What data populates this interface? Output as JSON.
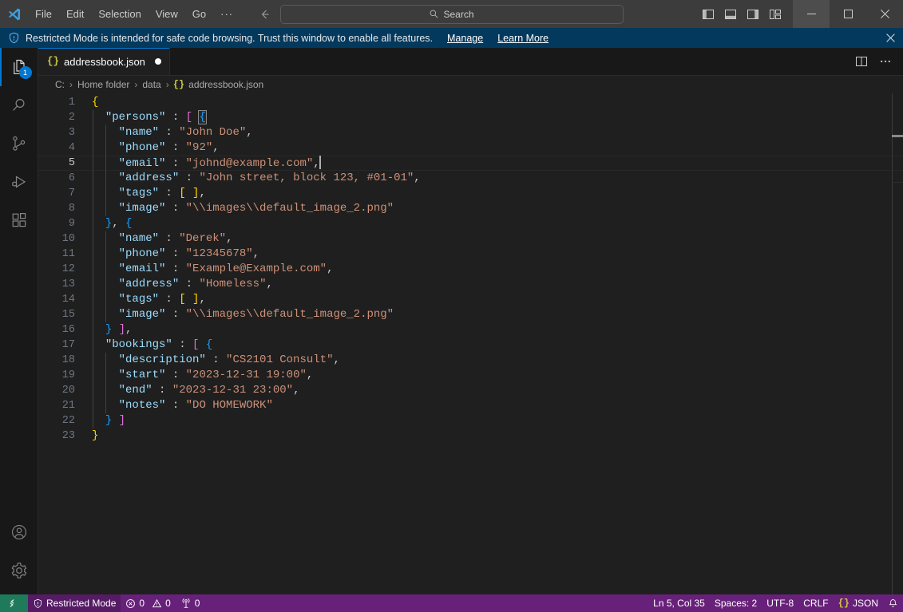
{
  "titlebar": {
    "logo_icon": "vscode-logo-icon",
    "menus": [
      {
        "label": "File",
        "name": "menu-file"
      },
      {
        "label": "Edit",
        "name": "menu-edit"
      },
      {
        "label": "Selection",
        "name": "menu-selection"
      },
      {
        "label": "View",
        "name": "menu-view"
      },
      {
        "label": "Go",
        "name": "menu-go"
      },
      {
        "label": "···",
        "name": "menu-more"
      }
    ],
    "nav": {
      "back_icon": "arrow-left-icon",
      "forward_icon": "arrow-right-icon"
    },
    "search": {
      "placeholder": "Search",
      "icon": "search-icon",
      "value": ""
    },
    "layout_buttons": [
      {
        "name": "toggle-primary-sidebar-button",
        "icon": "panel-left-icon"
      },
      {
        "name": "toggle-panel-button",
        "icon": "panel-bottom-icon"
      },
      {
        "name": "toggle-secondary-sidebar-button",
        "icon": "panel-right-icon"
      },
      {
        "name": "customize-layout-button",
        "icon": "layout-customize-icon"
      }
    ],
    "window_controls": [
      {
        "name": "minimize-button",
        "icon": "minimize-icon",
        "hovered": true
      },
      {
        "name": "maximize-button",
        "icon": "maximize-icon",
        "hovered": false
      },
      {
        "name": "close-button",
        "icon": "close-icon",
        "hovered": false
      }
    ]
  },
  "banner": {
    "icon": "shield-icon",
    "message": "Restricted Mode is intended for safe code browsing. Trust this window to enable all features.",
    "manage_label": "Manage",
    "learn_more_label": "Learn More",
    "close_icon": "close-icon"
  },
  "activitybar": {
    "top": [
      {
        "name": "sidebar-item-explorer",
        "icon": "files-icon",
        "active": true,
        "badge": "1"
      },
      {
        "name": "sidebar-item-search",
        "icon": "search-icon",
        "active": false,
        "badge": ""
      },
      {
        "name": "sidebar-item-source-control",
        "icon": "source-control-icon",
        "active": false,
        "badge": ""
      },
      {
        "name": "sidebar-item-run-debug",
        "icon": "run-and-debug-icon",
        "active": false,
        "badge": ""
      },
      {
        "name": "sidebar-item-extensions",
        "icon": "extensions-icon",
        "active": false,
        "badge": ""
      }
    ],
    "bottom": [
      {
        "name": "accounts-button",
        "icon": "account-icon"
      },
      {
        "name": "manage-settings-button",
        "icon": "gear-icon"
      }
    ]
  },
  "editor": {
    "tab": {
      "icon": "json-file-icon",
      "icon_glyph": "{}",
      "label": "addressbook.json",
      "dirty": true
    },
    "tab_actions": [
      {
        "name": "split-editor-right-button",
        "icon": "split-editor-icon"
      },
      {
        "name": "more-editor-actions-button",
        "icon": "ellipsis-icon"
      }
    ],
    "breadcrumbs": [
      {
        "label": "C:",
        "name": "breadcrumb-drive"
      },
      {
        "label": "Home folder",
        "name": "breadcrumb-home-folder"
      },
      {
        "label": "data",
        "name": "breadcrumb-data"
      },
      {
        "label": "addressbook.json",
        "name": "breadcrumb-file",
        "icon_glyph": "{}"
      }
    ],
    "separator": "›",
    "cursor_line": 5,
    "lines": [
      {
        "n": "1",
        "indent": 0,
        "tokens": [
          {
            "t": "{",
            "c": "tok-b1"
          }
        ]
      },
      {
        "n": "2",
        "indent": 1,
        "tokens": [
          {
            "t": "  ",
            "c": "tok-punct"
          },
          {
            "t": "\"persons\"",
            "c": "tok-key"
          },
          {
            "t": " : ",
            "c": "tok-punct"
          },
          {
            "t": "[",
            "c": "tok-b2"
          },
          {
            "t": " ",
            "c": "tok-punct"
          },
          {
            "t": "{",
            "c": "tok-b3 bracket-match"
          }
        ]
      },
      {
        "n": "3",
        "indent": 2,
        "tokens": [
          {
            "t": "    ",
            "c": "tok-punct"
          },
          {
            "t": "\"name\"",
            "c": "tok-key"
          },
          {
            "t": " : ",
            "c": "tok-punct"
          },
          {
            "t": "\"John Doe\"",
            "c": "tok-str"
          },
          {
            "t": ",",
            "c": "tok-punct"
          }
        ]
      },
      {
        "n": "4",
        "indent": 2,
        "tokens": [
          {
            "t": "    ",
            "c": "tok-punct"
          },
          {
            "t": "\"phone\"",
            "c": "tok-key"
          },
          {
            "t": " : ",
            "c": "tok-punct"
          },
          {
            "t": "\"92\"",
            "c": "tok-str"
          },
          {
            "t": ",",
            "c": "tok-punct"
          }
        ]
      },
      {
        "n": "5",
        "indent": 2,
        "current": true,
        "caret": true,
        "tokens": [
          {
            "t": "    ",
            "c": "tok-punct"
          },
          {
            "t": "\"email\"",
            "c": "tok-key"
          },
          {
            "t": " : ",
            "c": "tok-punct"
          },
          {
            "t": "\"johnd@example.com\"",
            "c": "tok-str"
          },
          {
            "t": ",",
            "c": "tok-punct"
          }
        ]
      },
      {
        "n": "6",
        "indent": 2,
        "tokens": [
          {
            "t": "    ",
            "c": "tok-punct"
          },
          {
            "t": "\"address\"",
            "c": "tok-key"
          },
          {
            "t": " : ",
            "c": "tok-punct"
          },
          {
            "t": "\"John street, block 123, #01-01\"",
            "c": "tok-str"
          },
          {
            "t": ",",
            "c": "tok-punct"
          }
        ]
      },
      {
        "n": "7",
        "indent": 2,
        "tokens": [
          {
            "t": "    ",
            "c": "tok-punct"
          },
          {
            "t": "\"tags\"",
            "c": "tok-key"
          },
          {
            "t": " : ",
            "c": "tok-punct"
          },
          {
            "t": "[ ]",
            "c": "tok-b1"
          },
          {
            "t": ",",
            "c": "tok-punct"
          }
        ]
      },
      {
        "n": "8",
        "indent": 2,
        "tokens": [
          {
            "t": "    ",
            "c": "tok-punct"
          },
          {
            "t": "\"image\"",
            "c": "tok-key"
          },
          {
            "t": " : ",
            "c": "tok-punct"
          },
          {
            "t": "\"\\\\images\\\\default_image_2.png\"",
            "c": "tok-str"
          }
        ]
      },
      {
        "n": "9",
        "indent": 1,
        "tokens": [
          {
            "t": "  ",
            "c": "tok-punct"
          },
          {
            "t": "}",
            "c": "tok-b3"
          },
          {
            "t": ", ",
            "c": "tok-punct"
          },
          {
            "t": "{",
            "c": "tok-b3"
          }
        ]
      },
      {
        "n": "10",
        "indent": 2,
        "tokens": [
          {
            "t": "    ",
            "c": "tok-punct"
          },
          {
            "t": "\"name\"",
            "c": "tok-key"
          },
          {
            "t": " : ",
            "c": "tok-punct"
          },
          {
            "t": "\"Derek\"",
            "c": "tok-str"
          },
          {
            "t": ",",
            "c": "tok-punct"
          }
        ]
      },
      {
        "n": "11",
        "indent": 2,
        "tokens": [
          {
            "t": "    ",
            "c": "tok-punct"
          },
          {
            "t": "\"phone\"",
            "c": "tok-key"
          },
          {
            "t": " : ",
            "c": "tok-punct"
          },
          {
            "t": "\"12345678\"",
            "c": "tok-str"
          },
          {
            "t": ",",
            "c": "tok-punct"
          }
        ]
      },
      {
        "n": "12",
        "indent": 2,
        "tokens": [
          {
            "t": "    ",
            "c": "tok-punct"
          },
          {
            "t": "\"email\"",
            "c": "tok-key"
          },
          {
            "t": " : ",
            "c": "tok-punct"
          },
          {
            "t": "\"Example@Example.com\"",
            "c": "tok-str"
          },
          {
            "t": ",",
            "c": "tok-punct"
          }
        ]
      },
      {
        "n": "13",
        "indent": 2,
        "tokens": [
          {
            "t": "    ",
            "c": "tok-punct"
          },
          {
            "t": "\"address\"",
            "c": "tok-key"
          },
          {
            "t": " : ",
            "c": "tok-punct"
          },
          {
            "t": "\"Homeless\"",
            "c": "tok-str"
          },
          {
            "t": ",",
            "c": "tok-punct"
          }
        ]
      },
      {
        "n": "14",
        "indent": 2,
        "tokens": [
          {
            "t": "    ",
            "c": "tok-punct"
          },
          {
            "t": "\"tags\"",
            "c": "tok-key"
          },
          {
            "t": " : ",
            "c": "tok-punct"
          },
          {
            "t": "[ ]",
            "c": "tok-b1"
          },
          {
            "t": ",",
            "c": "tok-punct"
          }
        ]
      },
      {
        "n": "15",
        "indent": 2,
        "tokens": [
          {
            "t": "    ",
            "c": "tok-punct"
          },
          {
            "t": "\"image\"",
            "c": "tok-key"
          },
          {
            "t": " : ",
            "c": "tok-punct"
          },
          {
            "t": "\"\\\\images\\\\default_image_2.png\"",
            "c": "tok-str"
          }
        ]
      },
      {
        "n": "16",
        "indent": 1,
        "tokens": [
          {
            "t": "  ",
            "c": "tok-punct"
          },
          {
            "t": "}",
            "c": "tok-b3"
          },
          {
            "t": " ",
            "c": "tok-punct"
          },
          {
            "t": "]",
            "c": "tok-b2"
          },
          {
            "t": ",",
            "c": "tok-punct"
          }
        ]
      },
      {
        "n": "17",
        "indent": 1,
        "tokens": [
          {
            "t": "  ",
            "c": "tok-punct"
          },
          {
            "t": "\"bookings\"",
            "c": "tok-key"
          },
          {
            "t": " : ",
            "c": "tok-punct"
          },
          {
            "t": "[",
            "c": "tok-b2"
          },
          {
            "t": " ",
            "c": "tok-punct"
          },
          {
            "t": "{",
            "c": "tok-b3"
          }
        ]
      },
      {
        "n": "18",
        "indent": 2,
        "tokens": [
          {
            "t": "    ",
            "c": "tok-punct"
          },
          {
            "t": "\"description\"",
            "c": "tok-key"
          },
          {
            "t": " : ",
            "c": "tok-punct"
          },
          {
            "t": "\"CS2101 Consult\"",
            "c": "tok-str"
          },
          {
            "t": ",",
            "c": "tok-punct"
          }
        ]
      },
      {
        "n": "19",
        "indent": 2,
        "tokens": [
          {
            "t": "    ",
            "c": "tok-punct"
          },
          {
            "t": "\"start\"",
            "c": "tok-key"
          },
          {
            "t": " : ",
            "c": "tok-punct"
          },
          {
            "t": "\"2023-12-31 19:00\"",
            "c": "tok-str"
          },
          {
            "t": ",",
            "c": "tok-punct"
          }
        ]
      },
      {
        "n": "20",
        "indent": 2,
        "tokens": [
          {
            "t": "    ",
            "c": "tok-punct"
          },
          {
            "t": "\"end\"",
            "c": "tok-key"
          },
          {
            "t": " : ",
            "c": "tok-punct"
          },
          {
            "t": "\"2023-12-31 23:00\"",
            "c": "tok-str"
          },
          {
            "t": ",",
            "c": "tok-punct"
          }
        ]
      },
      {
        "n": "21",
        "indent": 2,
        "tokens": [
          {
            "t": "    ",
            "c": "tok-punct"
          },
          {
            "t": "\"notes\"",
            "c": "tok-key"
          },
          {
            "t": " : ",
            "c": "tok-punct"
          },
          {
            "t": "\"DO HOMEWORK\"",
            "c": "tok-str"
          }
        ]
      },
      {
        "n": "22",
        "indent": 1,
        "tokens": [
          {
            "t": "  ",
            "c": "tok-punct"
          },
          {
            "t": "}",
            "c": "tok-b3"
          },
          {
            "t": " ",
            "c": "tok-punct"
          },
          {
            "t": "]",
            "c": "tok-b2"
          }
        ]
      },
      {
        "n": "23",
        "indent": 0,
        "tokens": [
          {
            "t": "}",
            "c": "tok-b1"
          }
        ]
      }
    ]
  },
  "statusbar": {
    "remote_label": "",
    "remote_icon": "remote-window-icon",
    "trust_label": "Restricted Mode",
    "trust_icon": "shield-icon",
    "errors_icon": "error-icon",
    "errors_count": "0",
    "warnings_icon": "warning-icon",
    "warnings_count": "0",
    "ports_icon": "radio-tower-icon",
    "ports_count": "0",
    "cursor_position": "Ln 5, Col 35",
    "indentation": "Spaces: 2",
    "encoding": "UTF-8",
    "eol": "CRLF",
    "language_icon_glyph": "{}",
    "language": "JSON",
    "notifications_icon": "bell-icon"
  },
  "colors": {
    "accent": "#0078d4",
    "statusbar_bg": "#68217a",
    "remote_bg": "#1f7a5c",
    "banner_bg": "#04395e",
    "editor_bg": "#1f1f1f",
    "titlebar_bg": "#3c3c3c"
  }
}
